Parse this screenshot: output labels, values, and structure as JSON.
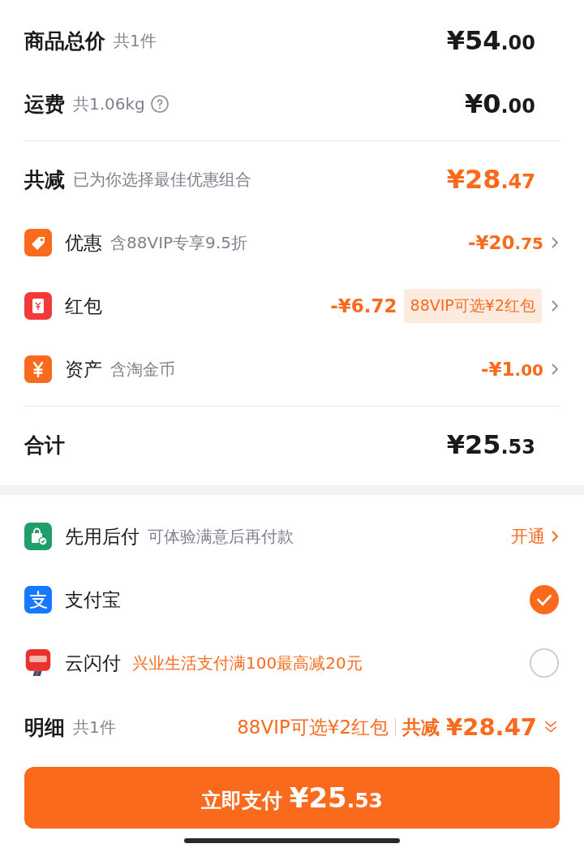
{
  "totals": [
    {
      "label": "商品总价",
      "note": "共1件",
      "main": "¥54",
      "cents": ".00"
    },
    {
      "label": "运费",
      "note": "共1.06kg",
      "main": "¥0",
      "cents": ".00"
    }
  ],
  "discount": {
    "label": "共减",
    "note": "已为你选择最佳优惠组合",
    "main": "¥28",
    "cents": ".47"
  },
  "discount_items": [
    {
      "label": "优惠",
      "note": "含88VIP专享9.5折",
      "main": "-¥20",
      "cents": ".75"
    },
    {
      "label": "红包",
      "main": "-¥6.72",
      "tag": "88VIP可选¥2红包"
    },
    {
      "label": "资产",
      "note": "含淘金币",
      "main": "-¥1",
      "cents": ".00"
    }
  ],
  "grand_total": {
    "label": "合计",
    "main": "¥25",
    "cents": ".53"
  },
  "payment_methods": [
    {
      "kind": "link",
      "label": "先用后付",
      "note": "可体验满意后再付款",
      "action": "开通"
    },
    {
      "kind": "radio",
      "label": "支付宝",
      "selected": true
    },
    {
      "kind": "radio",
      "label": "云闪付",
      "promo": "兴业生活支付满100最高减20元",
      "selected": false
    }
  ],
  "details": {
    "label": "明细",
    "note": "共1件",
    "promo": "88VIP可选¥2红包",
    "discount_label": "共减",
    "discount": "¥28.47"
  },
  "pay_button": {
    "label": "立即支付",
    "main": "¥25",
    "cents": ".53"
  }
}
